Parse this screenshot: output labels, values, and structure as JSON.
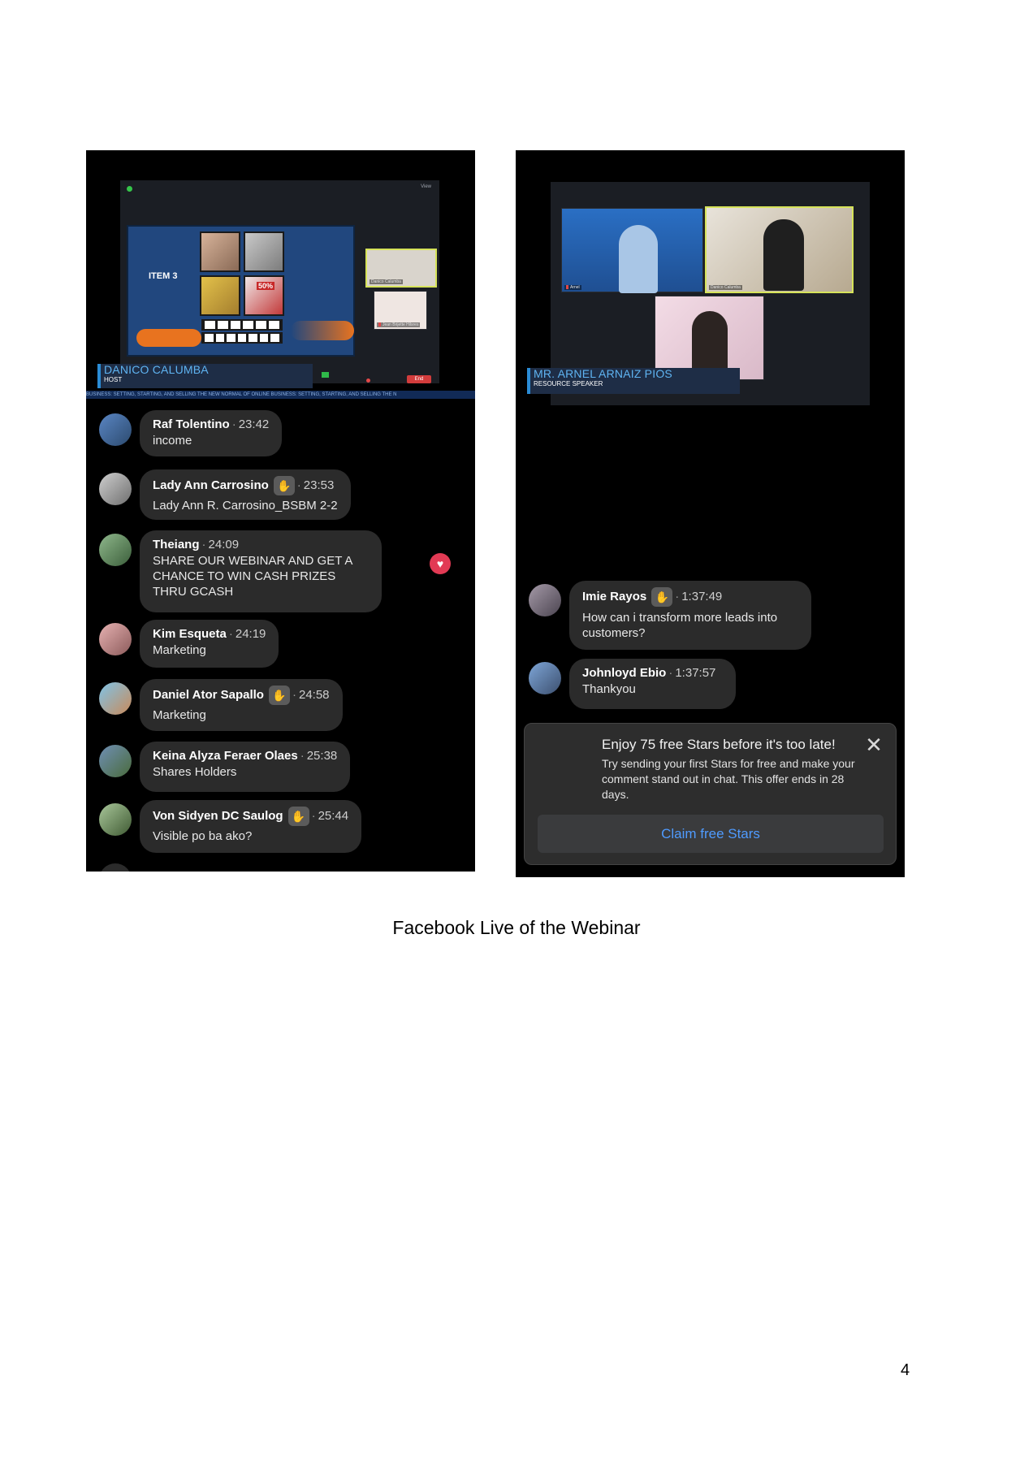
{
  "left_screenshot": {
    "zoom": {
      "view_label": "View",
      "slide_title": "ITEM 3",
      "sale_tag": "50%",
      "participants": [
        "Danico Calumba",
        "Jean Brijette Hilsres"
      ],
      "end_label": "End"
    },
    "lower_third": {
      "name": "DANICO CALUMBA",
      "role": "HOST"
    },
    "ticker": "BUSINESS: SETTING, STARTING, AND SELLING      THE NEW NORMAL OF ONLINE BUSINESS: SETTING, STARTING, AND SELLING      THE N",
    "comments": [
      {
        "name": "Raf Tolentino",
        "time": "23:42",
        "text": "income",
        "badge": false
      },
      {
        "name": "Lady Ann Carrosino",
        "time": "23:53",
        "text": "Lady Ann R. Carrosino_BSBM 2-2",
        "badge": true
      },
      {
        "name": "Theiang",
        "time": "24:09",
        "text": "SHARE OUR WEBINAR AND GET A CHANCE TO WIN CASH PRIZES THRU GCASH",
        "badge": false
      },
      {
        "name": "Kim Esqueta",
        "time": "24:19",
        "text": "Marketing",
        "badge": false
      },
      {
        "name": "Daniel Ator Sapallo",
        "time": "24:58",
        "text": "Marketing",
        "badge": true
      },
      {
        "name": "Keina Alyza Feraer Olaes",
        "time": "25:38",
        "text": "Shares Holders",
        "badge": false
      },
      {
        "name": "Von Sidyen DC Saulog",
        "time": "25:44",
        "text": "Visible po ba ako?",
        "badge": true
      }
    ]
  },
  "right_screenshot": {
    "zoom": {
      "participants": [
        "Arnel",
        "Danico Calumba"
      ]
    },
    "lower_third": {
      "name": "MR. ARNEL ARNAIZ PIOS",
      "role": "RESOURCE SPEAKER"
    },
    "comments": [
      {
        "name": "Imie Rayos",
        "time": "1:37:49",
        "text": "How can i transform more leads into customers?",
        "badge": true
      },
      {
        "name": "Johnloyd Ebio",
        "time": "1:37:57",
        "text": "Thankyou",
        "badge": false
      }
    ],
    "promo": {
      "title": "Enjoy 75 free Stars before it's too late!",
      "body": "Try sending your first Stars for free and make your comment stand out in chat. This offer ends in 28 days.",
      "button": "Claim free Stars"
    }
  },
  "caption": "Facebook Live of the Webinar",
  "page_number": "4",
  "colors": {
    "chat_bg": "#000000",
    "bubble": "#2b2b2b",
    "name_text": "#ffffff",
    "link_blue": "#4f9bff",
    "lower_third_blue": "#5fb4f2",
    "heart_red": "#e23a54"
  }
}
